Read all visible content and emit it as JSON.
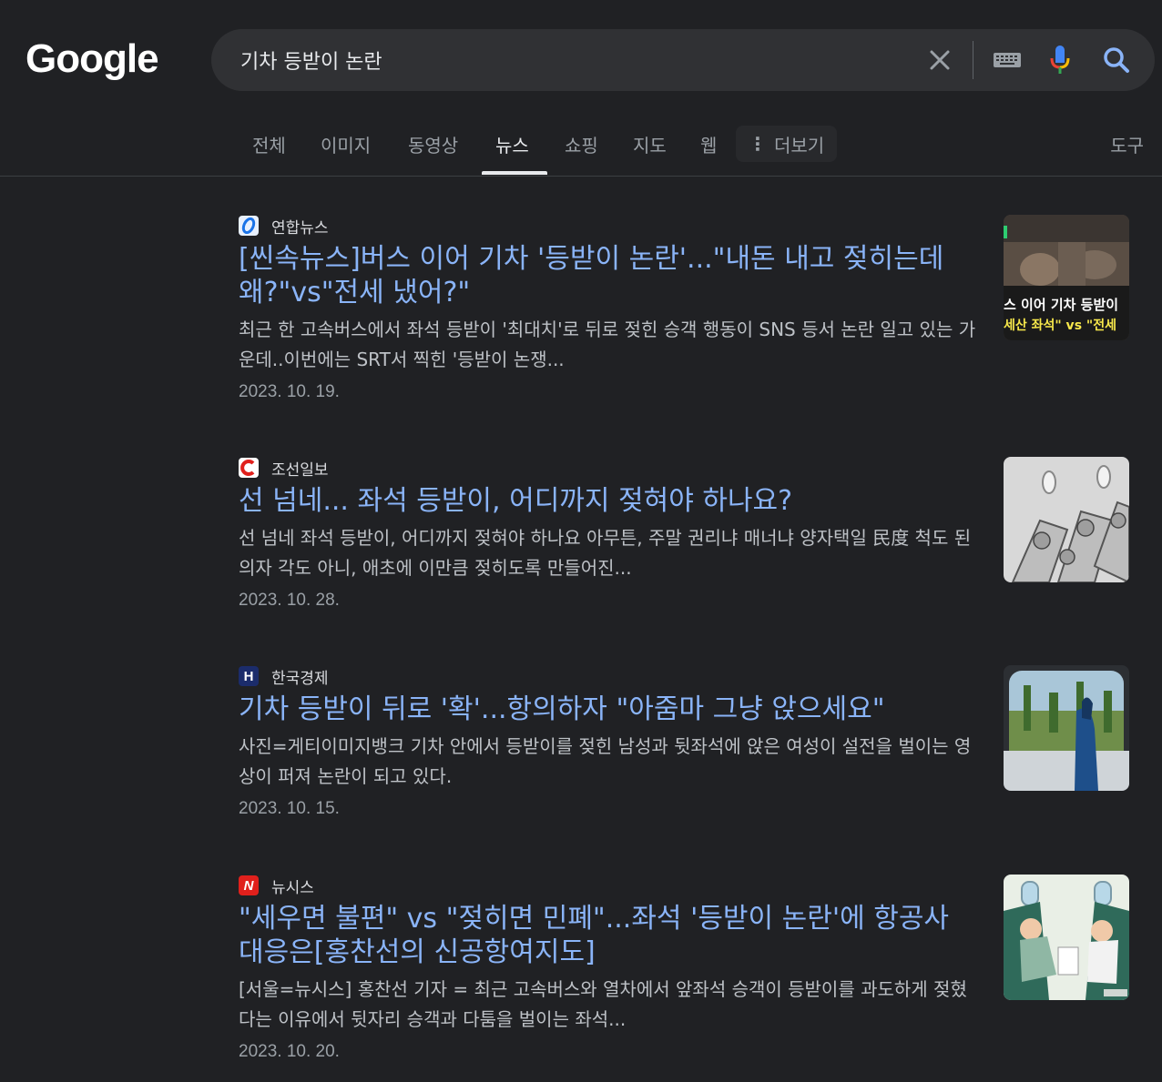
{
  "logo": "Google",
  "search": {
    "query": "기차 등받이 논란"
  },
  "tabs": [
    {
      "label": "전체"
    },
    {
      "label": "이미지"
    },
    {
      "label": "동영상"
    },
    {
      "label": "뉴스"
    },
    {
      "label": "쇼핑"
    },
    {
      "label": "지도"
    },
    {
      "label": "웹"
    }
  ],
  "more_label": "더보기",
  "tools_label": "도구",
  "results": [
    {
      "source": "연합뉴스",
      "title": "[씬속뉴스]버스 이어 기차 '등받이 논란'...\"내돈 내고 젖히는데 왜?\"vs\"전세 냈어?\"",
      "snippet": "최근 한 고속버스에서 좌석 등받이 '최대치'로 뒤로 젖힌 승객 행동이 SNS 등서 논란 일고 있는 가운데..이번에는 SRT서 찍힌 '등받이 논쟁...",
      "date": "2023. 10. 19.",
      "thumb_caption_1": "스 이어 기차 등받이",
      "thumb_caption_2": "세산 좌석\" vs \"전세"
    },
    {
      "source": "조선일보",
      "title": "선 넘네... 좌석 등받이, 어디까지 젖혀야 하나요?",
      "snippet": "선 넘네 좌석 등받이, 어디까지 젖혀야 하나요 아무튼, 주말 권리냐 매너냐 양자택일 民度 척도 된 의자 각도 아니, 애초에 이만큼 젖히도록 만들어진...",
      "date": "2023. 10. 28."
    },
    {
      "source": "한국경제",
      "title": "기차 등받이 뒤로 '확'...항의하자 \"아줌마 그냥 앉으세요\"",
      "snippet": "사진=게티이미지뱅크 기차 안에서 등받이를 젖힌 남성과 뒷좌석에 앉은 여성이 설전을 벌이는 영상이 퍼져 논란이 되고 있다.",
      "date": "2023. 10. 15."
    },
    {
      "source": "뉴시스",
      "title": "\"세우면 불편\" vs \"젖히면 민폐\"...좌석 '등받이 논란'에 항공사 대응은[홍찬선의 신공항여지도]",
      "snippet": "[서울=뉴시스] 홍찬선 기자 = 최근 고속버스와 열차에서 앞좌석 승객이 등받이를 과도하게 젖혔다는 이유에서 뒷자리 승객과 다툼을 벌이는 좌석...",
      "date": "2023. 10. 20."
    }
  ],
  "colors": {
    "background": "#202124",
    "link": "#8ab4f8",
    "text": "#bdc1c6"
  }
}
